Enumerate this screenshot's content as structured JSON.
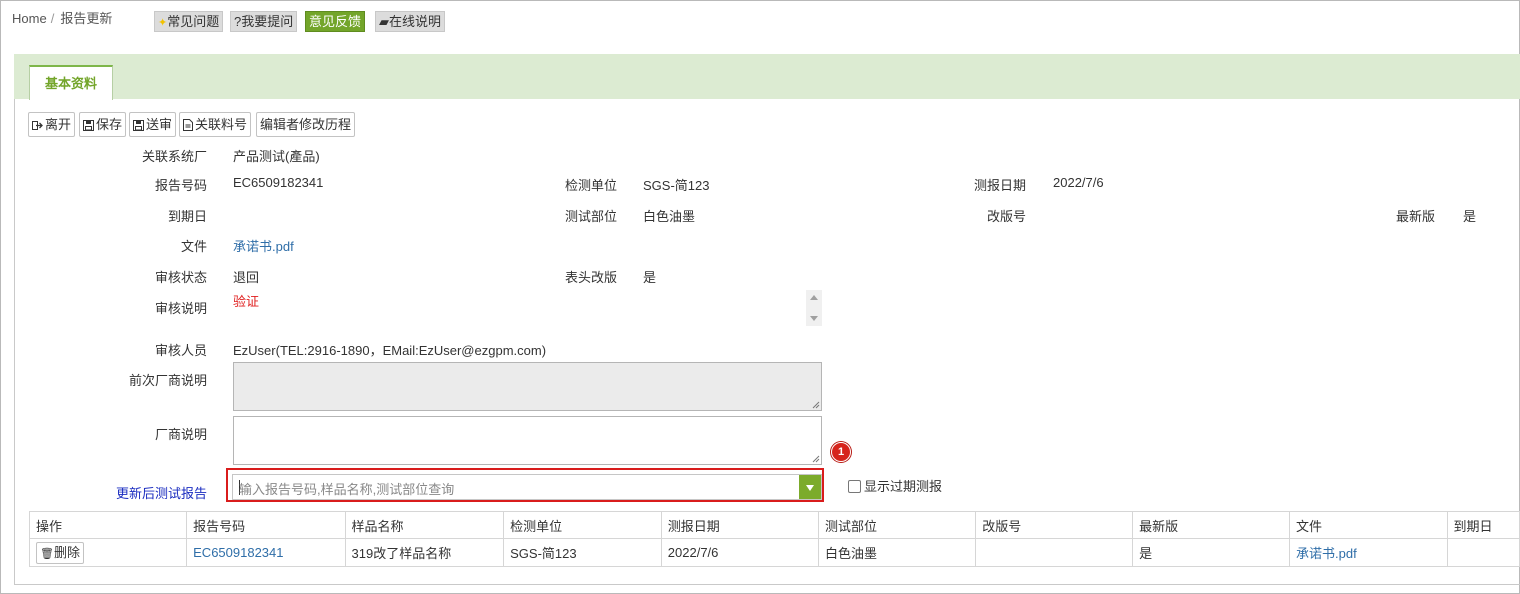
{
  "breadcrumb": {
    "home": "Home",
    "separator": "/",
    "current": "报告更新"
  },
  "top_buttons": {
    "faq": "常见问题",
    "ask": "?我要提问",
    "feedback": "意见反馈",
    "manual": "在线说明"
  },
  "tab": {
    "label": "基本资料"
  },
  "toolbar": {
    "leave": "离开",
    "save": "保存",
    "submit": "送审",
    "related": "关联料号",
    "history": "编辑者修改历程"
  },
  "fields": {
    "factory_label": "关联系统厂",
    "factory_value": "产品测试(產品)",
    "report_no_label": "报告号码",
    "report_no_value": "EC6509182341",
    "lab_label": "检测单位",
    "lab_value": "SGS-简123",
    "test_date_label": "测报日期",
    "test_date_value": "2022/7/6",
    "expiry_label": "到期日",
    "expiry_value": "",
    "part_label": "测试部位",
    "part_value": "白色油墨",
    "revision_label": "改版号",
    "revision_value": "",
    "latest_label": "最新版",
    "latest_value": "是",
    "file_label": "文件",
    "file_value": "承诺书.pdf",
    "status_label": "审核状态",
    "status_value": "退回",
    "header_rev_label": "表头改版",
    "header_rev_value": "是",
    "review_note_label": "审核说明",
    "review_note_value": "验证",
    "reviewer_label": "审核人员",
    "reviewer_value": "EzUser(TEL:2916-1890，EMail:EzUser@ezgpm.com)",
    "prev_vendor_note_label": "前次厂商说明",
    "vendor_note_label": "厂商说明",
    "updated_report_label": "更新后测试报告"
  },
  "search": {
    "placeholder": "输入报告号码,样品名称,测试部位查询"
  },
  "badge": "1",
  "show_expired": "显示过期测报",
  "table": {
    "headers": [
      "操作",
      "报告号码",
      "样品名称",
      "检测单位",
      "测报日期",
      "测试部位",
      "改版号",
      "最新版",
      "文件",
      "到期日"
    ],
    "rows": [
      {
        "action": "删除",
        "report_no": "EC6509182341",
        "sample": "319改了样品名称",
        "lab": "SGS-简123",
        "date": "2022/7/6",
        "part": "白色油墨",
        "revision": "",
        "latest": "是",
        "file": "承诺书.pdf",
        "expiry": ""
      }
    ]
  },
  "colors": {
    "accent_green": "#73a52a",
    "tab_bar": "#dcebd2",
    "link": "#2f6ea8",
    "highlight_red": "#d91c1c"
  }
}
